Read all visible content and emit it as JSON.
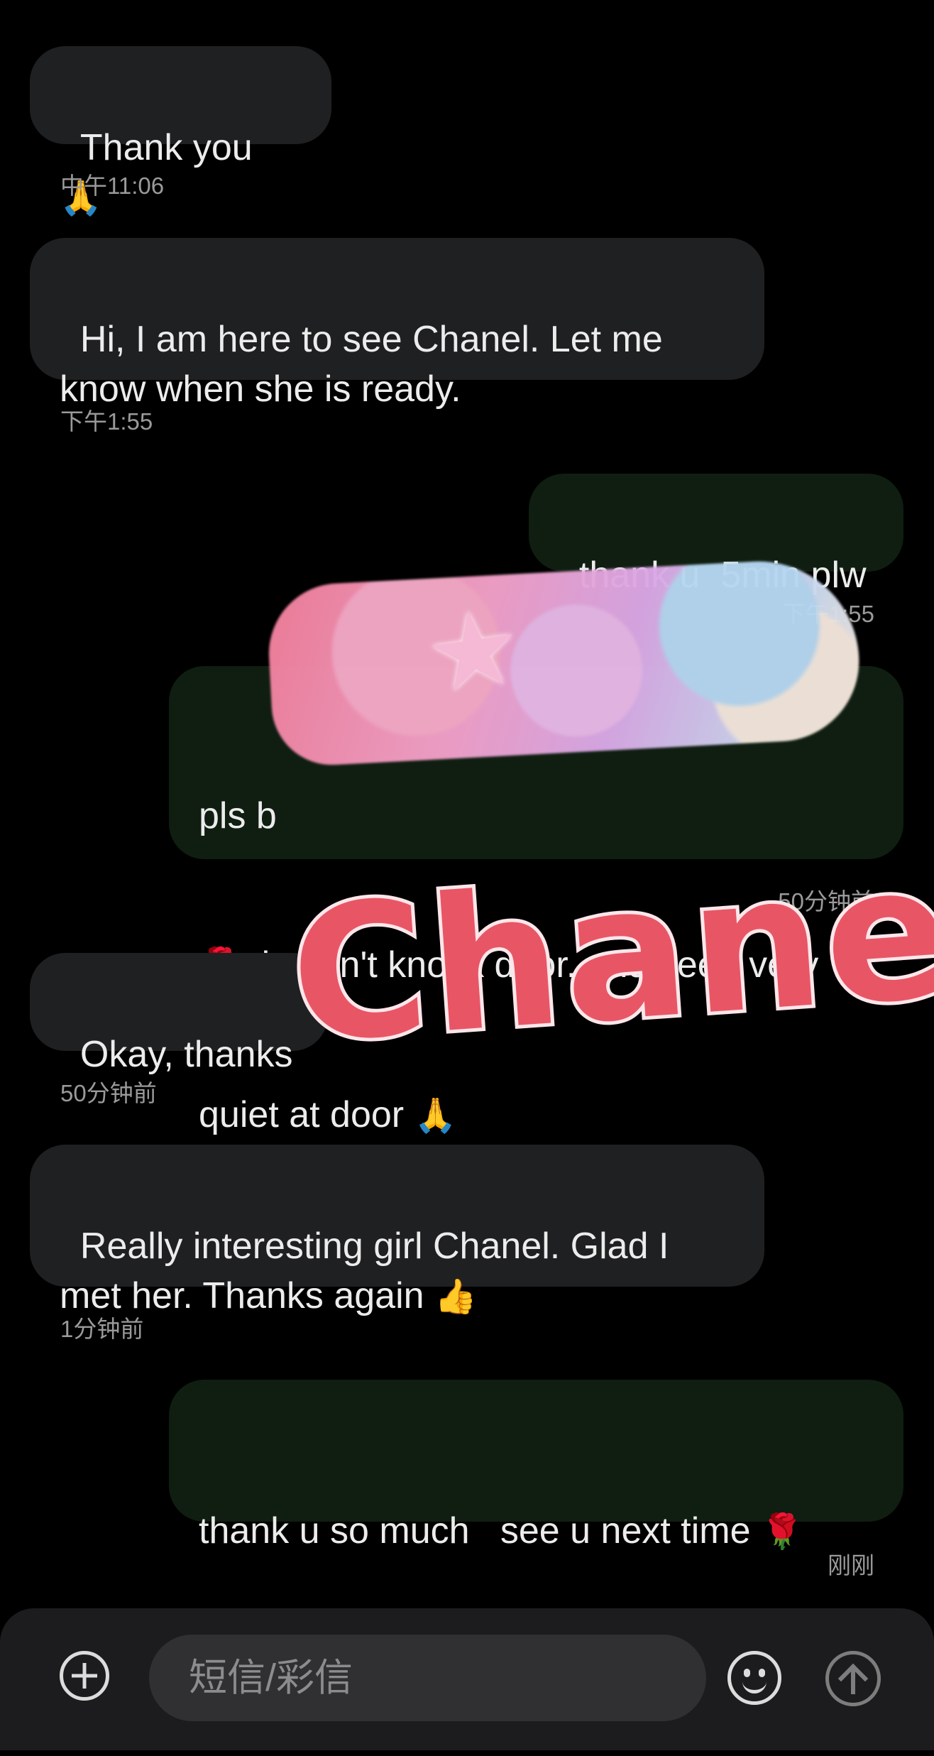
{
  "messages": [
    {
      "dir": "in",
      "text": "Thank you ",
      "emoji": "🙏",
      "time": "中午11:06"
    },
    {
      "dir": "in",
      "text": "Hi, I am here to see Chanel. Let me know when she is ready.",
      "time": "下午1:55"
    },
    {
      "dir": "out",
      "text": "thank u  5min plw",
      "time": "下午1:55"
    },
    {
      "dir": "out",
      "line1": "pls b",
      "line2_emoji": "🌹",
      "line2": "pls don't knock door. and keep very",
      "line3": "quiet at door ",
      "line3_emoji": "🙏",
      "time": "50分钟前"
    },
    {
      "dir": "in",
      "text": "Okay, thanks",
      "time": "50分钟前"
    },
    {
      "dir": "in",
      "text": "Really interesting girl Chanel. Glad I met her. Thanks again ",
      "emoji": "👍",
      "time": "1分钟前"
    },
    {
      "dir": "out",
      "text": "thank u so much   see u next time ",
      "emoji": "🌹",
      "emoji_line2": "🌹 🌹",
      "time": "刚刚"
    }
  ],
  "watermark": "Chanel",
  "composer": {
    "placeholder": "短信/彩信",
    "add_icon": "plus-circle-icon",
    "emoji_icon": "smiley-icon",
    "send_icon": "arrow-up-circle-icon"
  }
}
